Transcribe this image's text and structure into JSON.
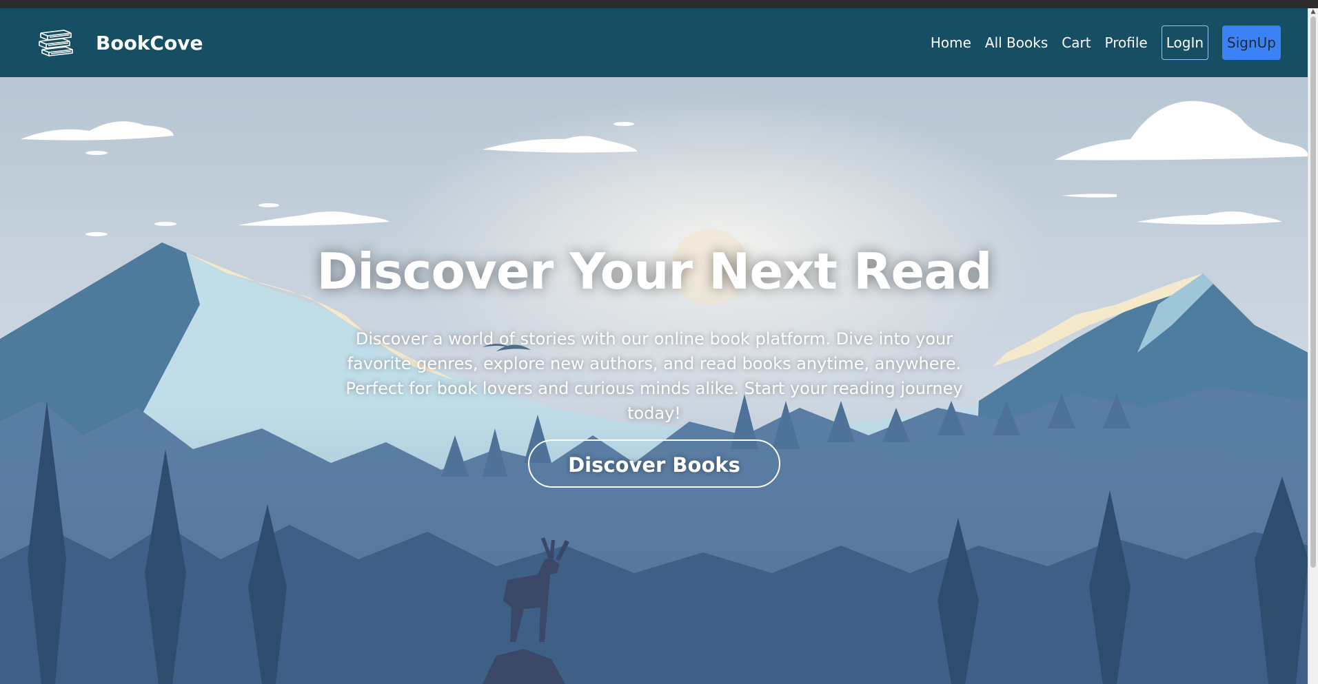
{
  "brand": {
    "name": "BookCove",
    "logo_icon": "books-stack-icon"
  },
  "nav": {
    "items": [
      {
        "label": "Home"
      },
      {
        "label": "All Books"
      },
      {
        "label": "Cart"
      },
      {
        "label": "Profile"
      }
    ],
    "login_label": "LogIn",
    "signup_label": "SignUp"
  },
  "hero": {
    "title": "Discover Your Next Read",
    "description": "Discover a world of stories with our online book platform. Dive into your favorite genres, explore new authors, and read books anytime, anywhere. Perfect for book lovers and curious minds alike. Start your reading journey today!",
    "cta_label": "Discover Books"
  },
  "colors": {
    "navbar": "#164e63",
    "signup_button": "#3b82f6",
    "sky": "#c6d3de"
  }
}
